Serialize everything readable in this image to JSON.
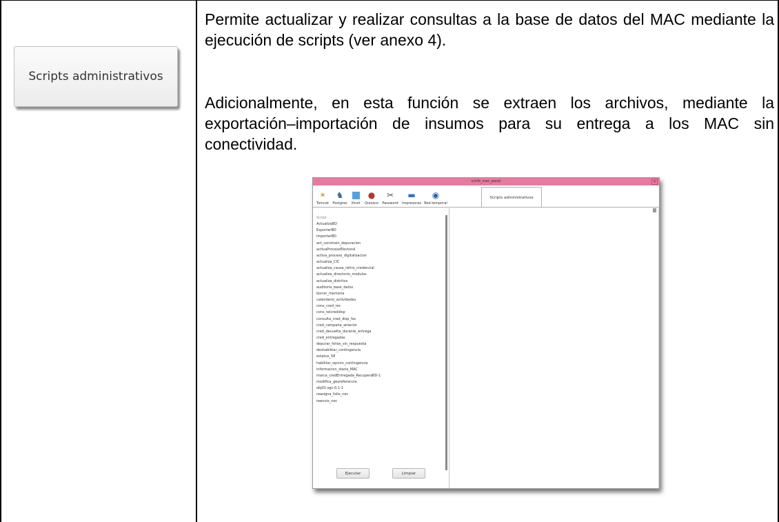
{
  "left_column": {
    "button_label": "Scripts administrativos"
  },
  "description": {
    "paragraph1": "Permite actualizar y realizar consultas a la base de datos del MAC mediante la ejecución de scripts (ver anexo 4).",
    "paragraph2": "Adicionalmente, en esta función se extraen los archivos, mediante la exportación–importación de insumos para su entrega a los MAC sin conectividad."
  },
  "window": {
    "title": "scirfe_mac_panel",
    "close_label": "×",
    "tabs": [
      {
        "label": "Tomcat",
        "icon": "tomcat-icon"
      },
      {
        "label": "Postgres",
        "icon": "postgres-icon"
      },
      {
        "label": "Xinet",
        "icon": "xinet-icon"
      },
      {
        "label": "Quiosco",
        "icon": "quiosco-icon"
      },
      {
        "label": "Password",
        "icon": "password-icon"
      },
      {
        "label": "Impresoras",
        "icon": "printer-icon"
      },
      {
        "label": "Red temporal",
        "icon": "network-icon"
      }
    ],
    "active_tab": "Scripts administrativos",
    "list_header": "Script",
    "scripts": [
      "ActualizaBD",
      "ExportarBD",
      "ImportarBD",
      "act_constrain_depuracion",
      "activaProcesoElectoral",
      "activa_proceso_digitalizacion",
      "actualiza_CIC",
      "actualiza_causa_retiro_credencial",
      "actualiza_directorio_modulos",
      "actualiza_distritos",
      "auditoria_base_datos",
      "borrar_memoria",
      "calendario_actividades",
      "cons_cred_rec",
      "cons_telcreddisp",
      "consulta_cred_disp_fec",
      "cred_campaña_anterior",
      "cred_devuelta_durante_entrega",
      "cred_entregadas",
      "depurar_folios_sin_respuesta",
      "deshabilitar_contingencia",
      "estatus_58",
      "habilitar_opcion_contingencia",
      "informacion_diaria_MAC",
      "marca_credEntregada_RecuperaBD-1",
      "modifica_georeferencia",
      "obj01-sgc-0.1-1",
      "reasigna_folio_nec",
      "reenvio_nec"
    ],
    "buttons": {
      "execute": "Ejecutar",
      "clear": "Limpiar"
    }
  }
}
